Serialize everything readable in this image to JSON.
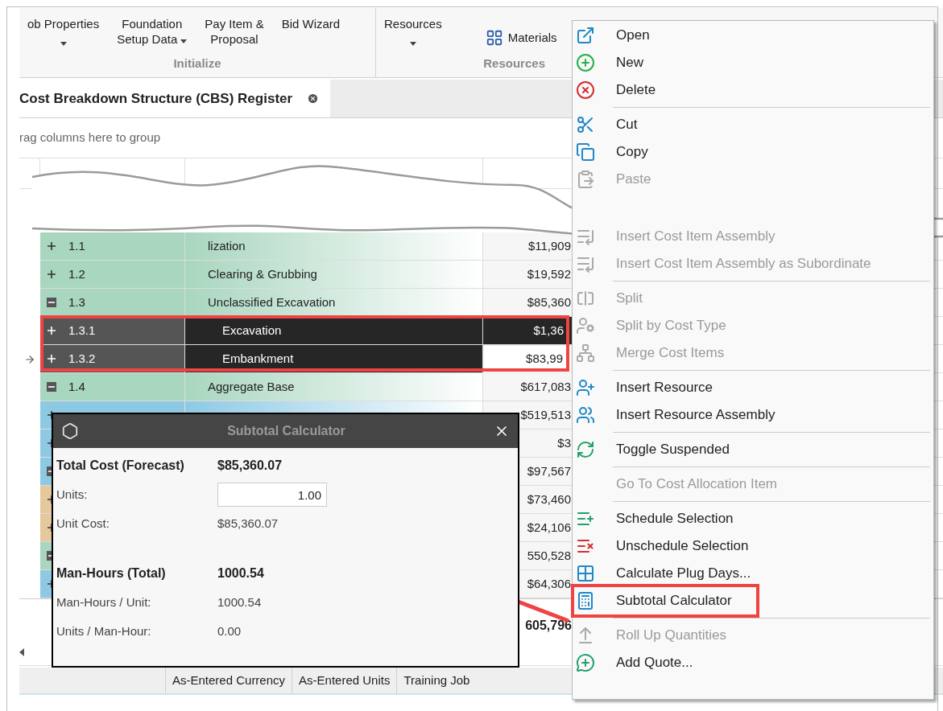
{
  "ribbon": {
    "groups": [
      {
        "label": "Initialize",
        "buttons": [
          {
            "label": "ob Properties",
            "caret_below": true
          },
          {
            "label": "Foundation\nSetup Data",
            "caret_inline": true
          },
          {
            "label": "Pay Item &\nProposal"
          },
          {
            "label": "Bid Wizard"
          }
        ]
      },
      {
        "label": "Resources",
        "buttons": [
          {
            "label": "Resources",
            "caret_below": true
          },
          {
            "label": "Materials",
            "kind": "small"
          }
        ]
      }
    ]
  },
  "tab": {
    "label": "Cost Breakdown Structure (CBS) Register",
    "selected": true
  },
  "group_panel": {
    "placeholder": "rag columns here to group"
  },
  "rows": [
    {
      "code": "1.1",
      "description": "lization",
      "cost": "$11,909",
      "color": "#a9d6bf",
      "expanded": false,
      "selected": false
    },
    {
      "code": "1.2",
      "description": "Clearing & Grubbing",
      "cost": "$19,592",
      "color": "#a9d6bf",
      "expanded": false,
      "selected": false
    },
    {
      "code": "1.3",
      "description": "Unclassified Excavation",
      "cost": "$85,360",
      "color": "#a9d6bf",
      "expanded": true,
      "selected": false,
      "children": [
        {
          "code": "1.3.1",
          "description": "Excavation",
          "cost": "$1,36",
          "expanded": false,
          "selected": true
        },
        {
          "code": "1.3.2",
          "description": "Embankment",
          "cost": "$83,99",
          "expanded": false,
          "selected": true,
          "current": true,
          "cost_focused": true
        }
      ]
    },
    {
      "code": "1.4",
      "description": "Aggregate Base",
      "cost": "$617,083",
      "color": "#a9d6bf",
      "expanded": true,
      "selected": false,
      "children": [
        {
          "cost": "$519,513",
          "color": "#8ec9e4"
        },
        {
          "cost": "$3",
          "color": "#8ec9e4"
        },
        {
          "cost": "$97,567",
          "color": "#8ec9e4",
          "expanded": true,
          "children": [
            {
              "cost": "$73,460",
              "color": "#e5c89b"
            },
            {
              "cost": "$24,106",
              "color": "#e5c89b"
            }
          ]
        }
      ]
    },
    {
      "cost": "550,528",
      "color": "#a9d6bf",
      "expanded": true,
      "children": [
        {
          "cost": "$64,306",
          "color": "#8ec9e4"
        }
      ]
    }
  ],
  "total": "605,796",
  "context_menu": {
    "items": [
      {
        "kind": "item",
        "label": "Open",
        "disabled": false
      },
      {
        "kind": "item",
        "label": "New",
        "disabled": false
      },
      {
        "kind": "item",
        "label": "Delete",
        "disabled": false
      },
      {
        "kind": "separator"
      },
      {
        "kind": "item",
        "label": "Cut",
        "disabled": false
      },
      {
        "kind": "item",
        "label": "Copy",
        "disabled": false
      },
      {
        "kind": "item",
        "label": "Paste",
        "disabled": true
      },
      {
        "kind": "gap"
      },
      {
        "kind": "item",
        "label": "Insert Cost Item Assembly",
        "disabled": true
      },
      {
        "kind": "item",
        "label": "Insert Cost Item Assembly as Subordinate",
        "disabled": true
      },
      {
        "kind": "separator"
      },
      {
        "kind": "item",
        "label": "Split",
        "disabled": true
      },
      {
        "kind": "item",
        "label": "Split by Cost Type",
        "disabled": true
      },
      {
        "kind": "item",
        "label": "Merge Cost Items",
        "disabled": true
      },
      {
        "kind": "separator"
      },
      {
        "kind": "item",
        "label": "Insert Resource",
        "disabled": false
      },
      {
        "kind": "item",
        "label": "Insert Resource Assembly",
        "disabled": false
      },
      {
        "kind": "separator"
      },
      {
        "kind": "item",
        "label": "Toggle Suspended",
        "disabled": false
      },
      {
        "kind": "separator"
      },
      {
        "kind": "item",
        "label": "Go To Cost Allocation Item",
        "disabled": true
      },
      {
        "kind": "separator"
      },
      {
        "kind": "item",
        "label": "Schedule Selection",
        "disabled": false
      },
      {
        "kind": "item",
        "label": "Unschedule Selection",
        "disabled": false
      },
      {
        "kind": "item",
        "label": "Calculate Plug Days...",
        "disabled": false
      },
      {
        "kind": "item",
        "label": "Subtotal Calculator",
        "disabled": false,
        "highlighted": true
      },
      {
        "kind": "separator"
      },
      {
        "kind": "item",
        "label": "Roll Up Quantities",
        "disabled": true
      },
      {
        "kind": "item",
        "label": "Add Quote...",
        "disabled": false
      }
    ]
  },
  "calculator": {
    "title": "Subtotal Calculator",
    "sections": [
      [
        {
          "kind": "bold",
          "label": "Total Cost (Forecast)",
          "value": "$85,360.07"
        },
        {
          "kind": "field",
          "label": "Units:",
          "value": "1.00"
        },
        {
          "kind": "plain",
          "label": "Unit Cost:",
          "value": "$85,360.07"
        }
      ],
      [
        {
          "kind": "bold",
          "label": "Man-Hours (Total)",
          "value": "1000.54"
        },
        {
          "kind": "plain",
          "label": "Man-Hours / Unit:",
          "value": "1000.54"
        },
        {
          "kind": "plain",
          "label": "Units / Man-Hour:",
          "value": "0.00"
        }
      ]
    ]
  },
  "status_bar": [
    "As-Entered Currency",
    "As-Entered Units",
    "Training Job"
  ]
}
